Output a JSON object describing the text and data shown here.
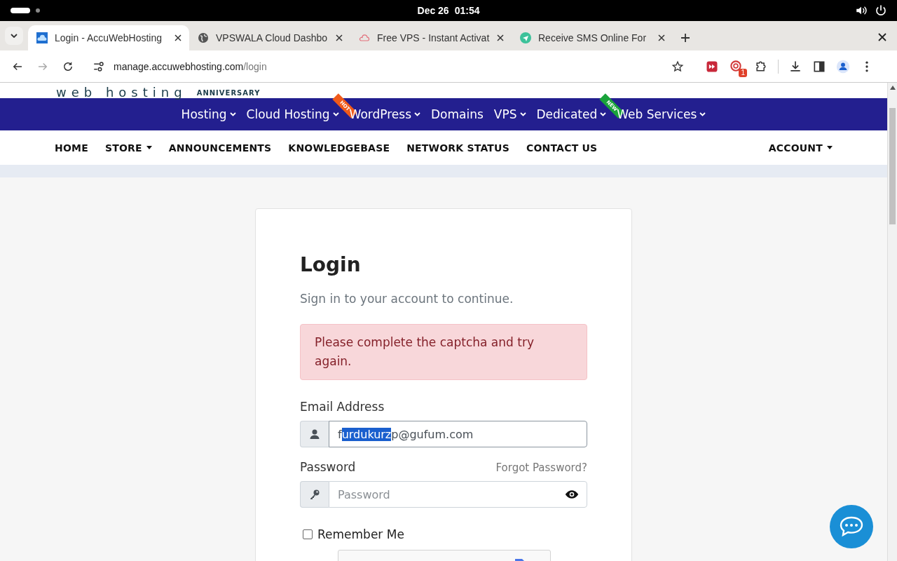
{
  "system_bar": {
    "date": "Dec 26",
    "time": "01:54"
  },
  "tabs": [
    {
      "title": "Login - AccuWebHosting",
      "kind": "cloud-square",
      "selected": true
    },
    {
      "title": "VPSWALA Cloud Dashbo",
      "kind": "globe",
      "selected": false
    },
    {
      "title": "Free VPS - Instant Activat",
      "kind": "cloud-outline",
      "selected": false
    },
    {
      "title": "Receive SMS Online For",
      "kind": "send",
      "selected": false
    }
  ],
  "address_bar": {
    "host": "manage.accuwebhosting.com",
    "path": "/login"
  },
  "toolbar": {
    "extension_badge": "1"
  },
  "site": {
    "logo": {
      "text": "web hosting",
      "tag": "ANNIVERSARY"
    },
    "main_nav": [
      {
        "label": "Hosting",
        "dropdown": true
      },
      {
        "label": "Cloud Hosting",
        "dropdown": true,
        "ribbon": {
          "text": "HOT",
          "color": "#f05a1a"
        }
      },
      {
        "label": "WordPress",
        "dropdown": true
      },
      {
        "label": "Domains",
        "dropdown": false
      },
      {
        "label": "VPS",
        "dropdown": true
      },
      {
        "label": "Dedicated",
        "dropdown": true,
        "ribbon": {
          "text": "NEW",
          "color": "#1aa33a"
        }
      },
      {
        "label": "Web Services",
        "dropdown": true
      }
    ],
    "secondary_nav": [
      {
        "label": "HOME",
        "dropdown": false
      },
      {
        "label": "STORE",
        "dropdown": true
      },
      {
        "label": "ANNOUNCEMENTS",
        "dropdown": false
      },
      {
        "label": "KNOWLEDGEBASE",
        "dropdown": false
      },
      {
        "label": "NETWORK STATUS",
        "dropdown": false
      },
      {
        "label": "CONTACT US",
        "dropdown": false
      }
    ],
    "account_menu": {
      "label": "ACCOUNT",
      "dropdown": true
    }
  },
  "login": {
    "title": "Login",
    "subtitle": "Sign in to your account to continue.",
    "alert": "Please complete the captcha and try again.",
    "email": {
      "label": "Email Address",
      "value_parts": [
        {
          "text": "f",
          "selected": false
        },
        {
          "text": "urdukurz",
          "selected": true
        },
        {
          "text": "p@gufum.com",
          "selected": false
        }
      ]
    },
    "password": {
      "label": "Password",
      "forgot_link": "Forgot Password?",
      "placeholder": "Password"
    },
    "remember_me": {
      "label": "Remember Me",
      "checked": false
    }
  }
}
